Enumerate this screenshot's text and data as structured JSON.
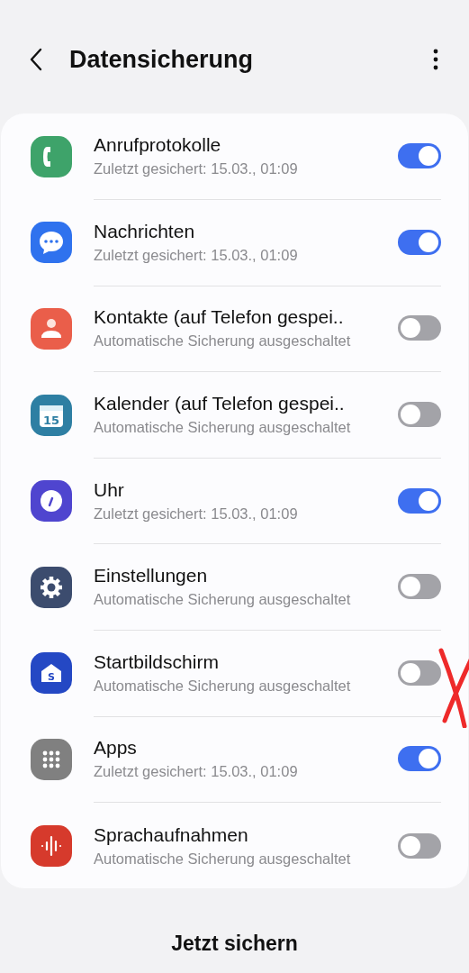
{
  "header": {
    "title": "Datensicherung"
  },
  "items": [
    {
      "title": "Anrufprotokolle",
      "subtitle": "Zuletzt gesichert: 15.03., 01:09",
      "on": true
    },
    {
      "title": "Nachrichten",
      "subtitle": "Zuletzt gesichert: 15.03., 01:09",
      "on": true
    },
    {
      "title": "Kontakte (auf Telefon gespei..",
      "subtitle": "Automatische Sicherung ausgeschaltet",
      "on": false
    },
    {
      "title": "Kalender (auf Telefon gespei..",
      "subtitle": "Automatische Sicherung ausgeschaltet",
      "on": false
    },
    {
      "title": "Uhr",
      "subtitle": "Zuletzt gesichert: 15.03., 01:09",
      "on": true
    },
    {
      "title": "Einstellungen",
      "subtitle": "Automatische Sicherung ausgeschaltet",
      "on": false
    },
    {
      "title": "Startbildschirm",
      "subtitle": "Automatische Sicherung ausgeschaltet",
      "on": false
    },
    {
      "title": "Apps",
      "subtitle": "Zuletzt gesichert: 15.03., 01:09",
      "on": true
    },
    {
      "title": "Sprachaufnahmen",
      "subtitle": "Automatische Sicherung ausgeschaltet",
      "on": false
    }
  ],
  "action": {
    "label": "Jetzt sichern"
  },
  "calendar_icon": {
    "day": "15"
  },
  "home_icon": {
    "letter": "S"
  }
}
